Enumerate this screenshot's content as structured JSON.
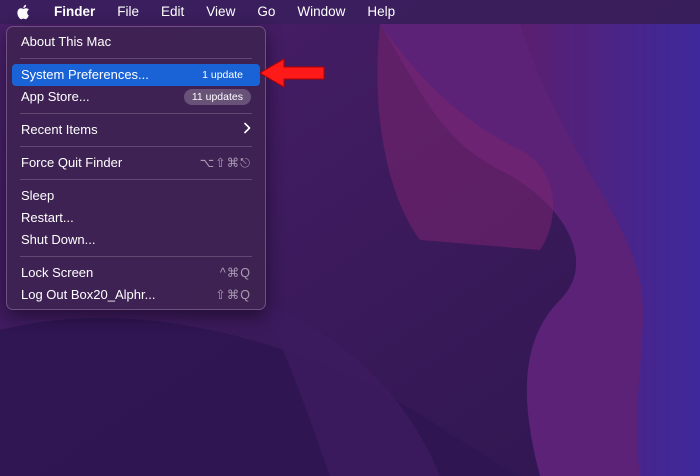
{
  "menubar": {
    "apple_icon": "apple-logo-icon",
    "app_name": "Finder",
    "items": [
      "File",
      "Edit",
      "View",
      "Go",
      "Window",
      "Help"
    ]
  },
  "apple_menu": {
    "about": "About This Mac",
    "system_prefs": {
      "label": "System Preferences...",
      "badge": "1 update"
    },
    "app_store": {
      "label": "App Store...",
      "badge": "11 updates"
    },
    "recent_items": {
      "label": "Recent Items",
      "icon": "chevron-right-icon"
    },
    "force_quit": {
      "label": "Force Quit Finder",
      "shortcut": "⌥⇧⌘⎋"
    },
    "sleep": "Sleep",
    "restart": "Restart...",
    "shut_down": "Shut Down...",
    "lock_screen": {
      "label": "Lock Screen",
      "shortcut": "^⌘Q"
    },
    "log_out": {
      "label": "Log Out Box20_Alphr...",
      "shortcut": "⇧⌘Q"
    }
  },
  "colors": {
    "selection": "#1a63d6",
    "annotation_arrow": "#ff1a1a"
  }
}
